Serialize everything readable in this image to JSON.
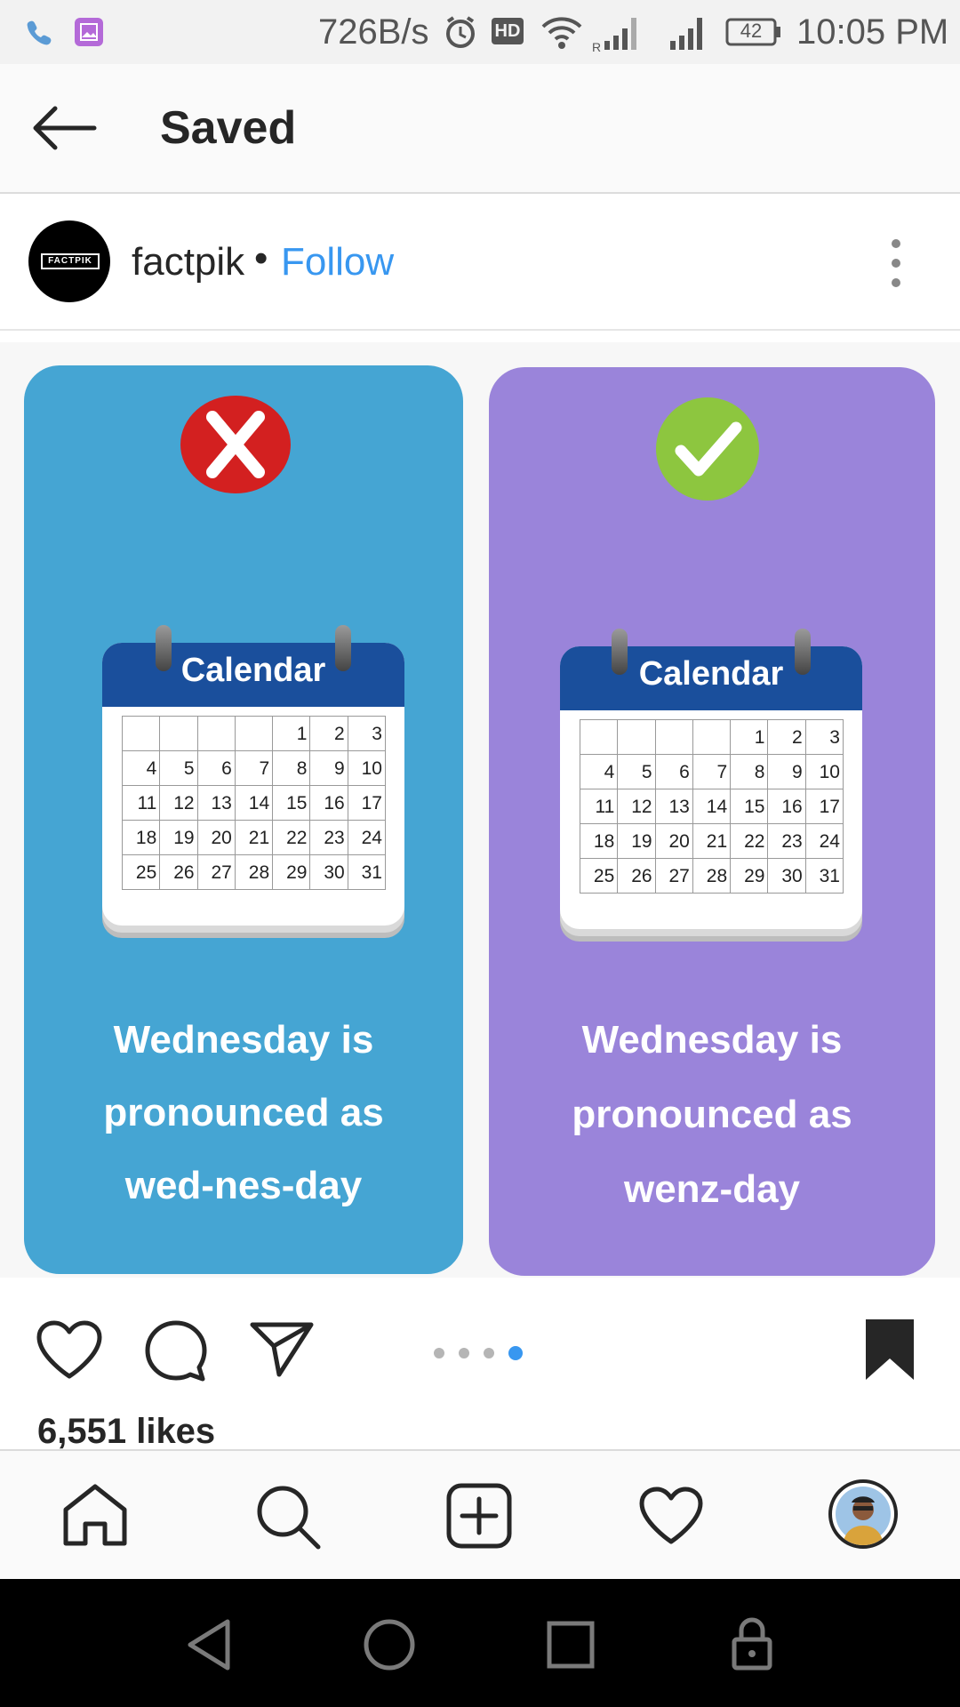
{
  "status_bar": {
    "net_speed": "726B/s",
    "hd": "HD",
    "battery": "42",
    "time": "10:05 PM"
  },
  "header": {
    "title": "Saved"
  },
  "post": {
    "username": "factpik",
    "separator": "•",
    "follow_label": "Follow",
    "avatar_text": "FACTPIK",
    "cards": [
      {
        "calendar_title": "Calendar",
        "line1": "Wednesday is",
        "line2": "pronounced as",
        "line3": "wed-nes-day",
        "bg": "#45a5d3",
        "mark": "cross"
      },
      {
        "calendar_title": "Calendar",
        "line1": "Wednesday is",
        "line2": "pronounced as",
        "line3": "wenz-day",
        "bg": "#9a84da",
        "mark": "check"
      }
    ],
    "calendar_days": [
      "",
      "",
      "",
      "",
      "1",
      "2",
      "3",
      "4",
      "5",
      "6",
      "7",
      "8",
      "9",
      "10",
      "11",
      "12",
      "13",
      "14",
      "15",
      "16",
      "17",
      "18",
      "19",
      "20",
      "21",
      "22",
      "23",
      "24",
      "25",
      "26",
      "27",
      "28",
      "29",
      "30",
      "31"
    ],
    "carousel": {
      "total": 4,
      "active": 4
    },
    "likes": "6,551 likes"
  },
  "tabs": [
    "home-icon",
    "search-icon",
    "new-post-icon",
    "activity-icon",
    "profile-icon"
  ],
  "colors": {
    "accent": "#3897f0",
    "cross": "#d32020",
    "check": "#8dc63f"
  }
}
